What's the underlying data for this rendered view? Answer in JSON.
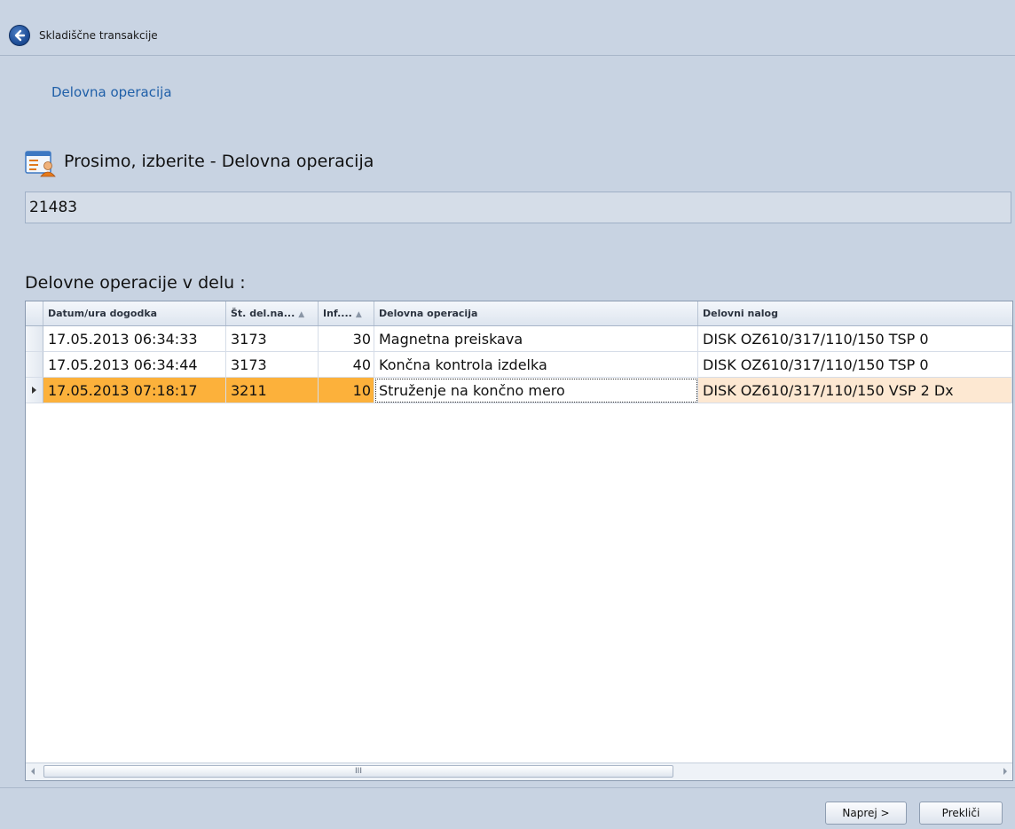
{
  "header": {
    "title": "Skladiščne transakcije"
  },
  "step": {
    "link_text": "Delovna operacija"
  },
  "prompt": {
    "text": "Prosimo, izberite - Delovna operacija",
    "icon": "form-user-icon"
  },
  "selected_value": "21483",
  "section_label": "Delovne operacije v delu :",
  "grid": {
    "columns": [
      "Datum/ura dogodka",
      "Št. del.na...",
      "Inf....",
      "Delovna operacija",
      "Delovni nalog"
    ],
    "rows": [
      [
        "17.05.2013 06:34:33",
        "3173",
        "30",
        "Magnetna preiskava",
        "DISK OZ610/317/110/150 TSP 0"
      ],
      [
        "17.05.2013 06:34:44",
        "3173",
        "40",
        "Končna kontrola izdelka",
        "DISK OZ610/317/110/150 TSP 0"
      ],
      [
        "17.05.2013 07:18:17",
        "3211",
        "10",
        "Struženje na končno mero",
        "DISK OZ610/317/110/150 VSP 2 Dx"
      ]
    ],
    "selected_row": 2,
    "scroll_grip": "III"
  },
  "buttons": {
    "next": "Naprej >",
    "cancel": "Prekliči"
  },
  "colors": {
    "selected_row": "#fcb13b",
    "link": "#1f5fa8",
    "background": "#c8d3e2"
  }
}
